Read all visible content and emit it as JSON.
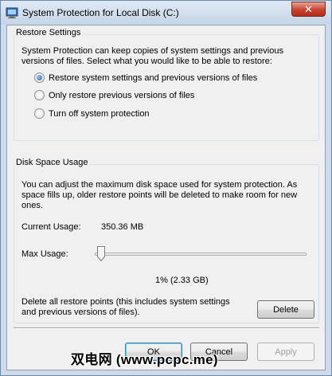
{
  "window": {
    "title": "System Protection for Local Disk (C:)",
    "close_glyph": "✕",
    "icon": "system-properties-icon"
  },
  "restore_settings": {
    "heading": "Restore Settings",
    "description": "System Protection can keep copies of system settings and previous versions of files. Select what you would like to be able to restore:",
    "options": [
      {
        "label": "Restore system settings and previous versions of files",
        "selected": true
      },
      {
        "label": "Only restore previous versions of files",
        "selected": false
      },
      {
        "label": "Turn off system protection",
        "selected": false
      }
    ]
  },
  "disk_space": {
    "heading": "Disk Space Usage",
    "description": "You can adjust the maximum disk space used for system protection. As space fills up, older restore points will be deleted to make room for new ones.",
    "current_usage_label": "Current Usage:",
    "current_usage_value": "350.36 MB",
    "max_usage_label": "Max Usage:",
    "max_usage_fraction": 0.01,
    "max_usage_readout": "1% (2.33 GB)",
    "delete_description": "Delete all restore points (this includes system settings and previous versions of files).",
    "delete_label": "Delete"
  },
  "footer": {
    "ok_label": "OK",
    "cancel_label": "Cancel",
    "apply_label": "Apply"
  },
  "watermark": "双电网 (www.pcpc.me)",
  "colors": {
    "title_bar": "#c5d5e7",
    "close_button": "#c7432f",
    "dialog_bg": "#f0f0f0",
    "group_border": "#d5dfe5",
    "default_button_border": "#3c7fb1"
  }
}
